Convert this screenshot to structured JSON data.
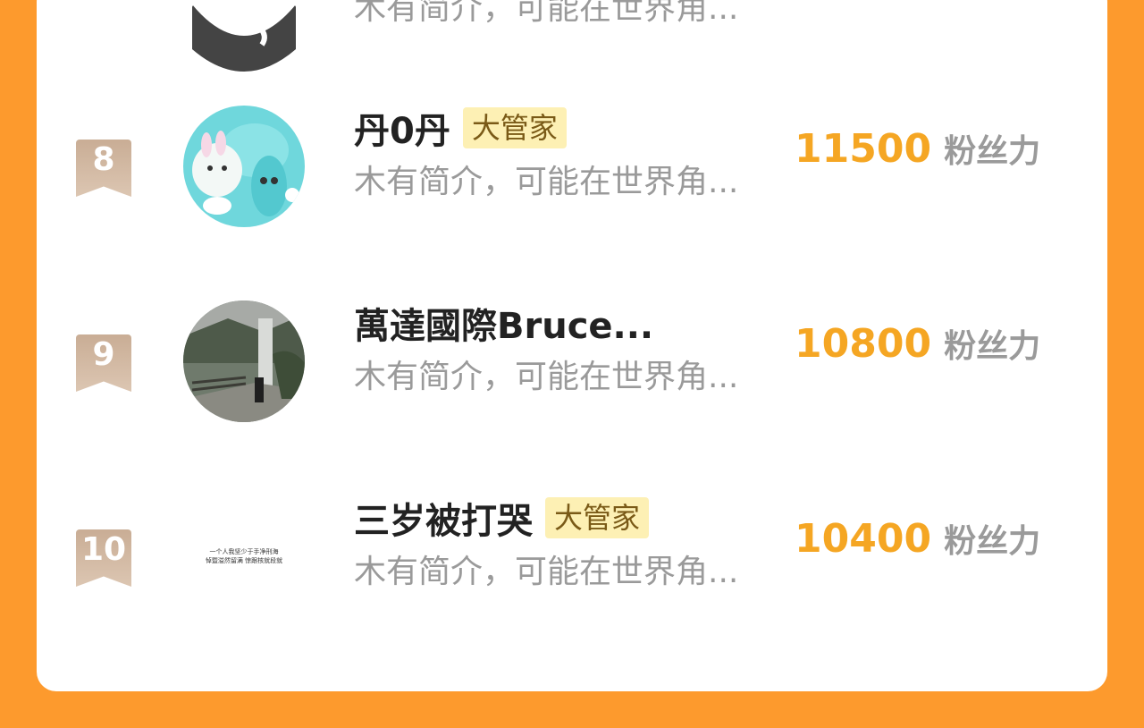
{
  "rows": [
    {
      "bio": "木有简介，可能在世界角..."
    },
    {
      "rank": "8",
      "name": "丹0丹",
      "badge": "大管家",
      "bio": "木有简介，可能在世界角...",
      "score": "11500",
      "score_label": "粉丝力",
      "avatar_icon": "cartoon-avatar-icon"
    },
    {
      "rank": "9",
      "name": "萬達國際Bruce...",
      "bio": "木有简介，可能在世界角...",
      "score": "10800",
      "score_label": "粉丝力",
      "avatar_icon": "photo-avatar-icon"
    },
    {
      "rank": "10",
      "name": "三岁被打哭",
      "badge": "大管家",
      "bio": "木有简介，可能在世界角...",
      "score": "10400",
      "score_label": "粉丝力",
      "avatar_icon": "text-avatar-icon",
      "avatar_text": [
        "一个人我坚少于手净刑海",
        "悼暨溢然留满 惊跟核就段就"
      ]
    }
  ],
  "colors": {
    "accent": "#fd9a2d",
    "score": "#f5a623",
    "badge_bg": "#fdf0b4"
  }
}
